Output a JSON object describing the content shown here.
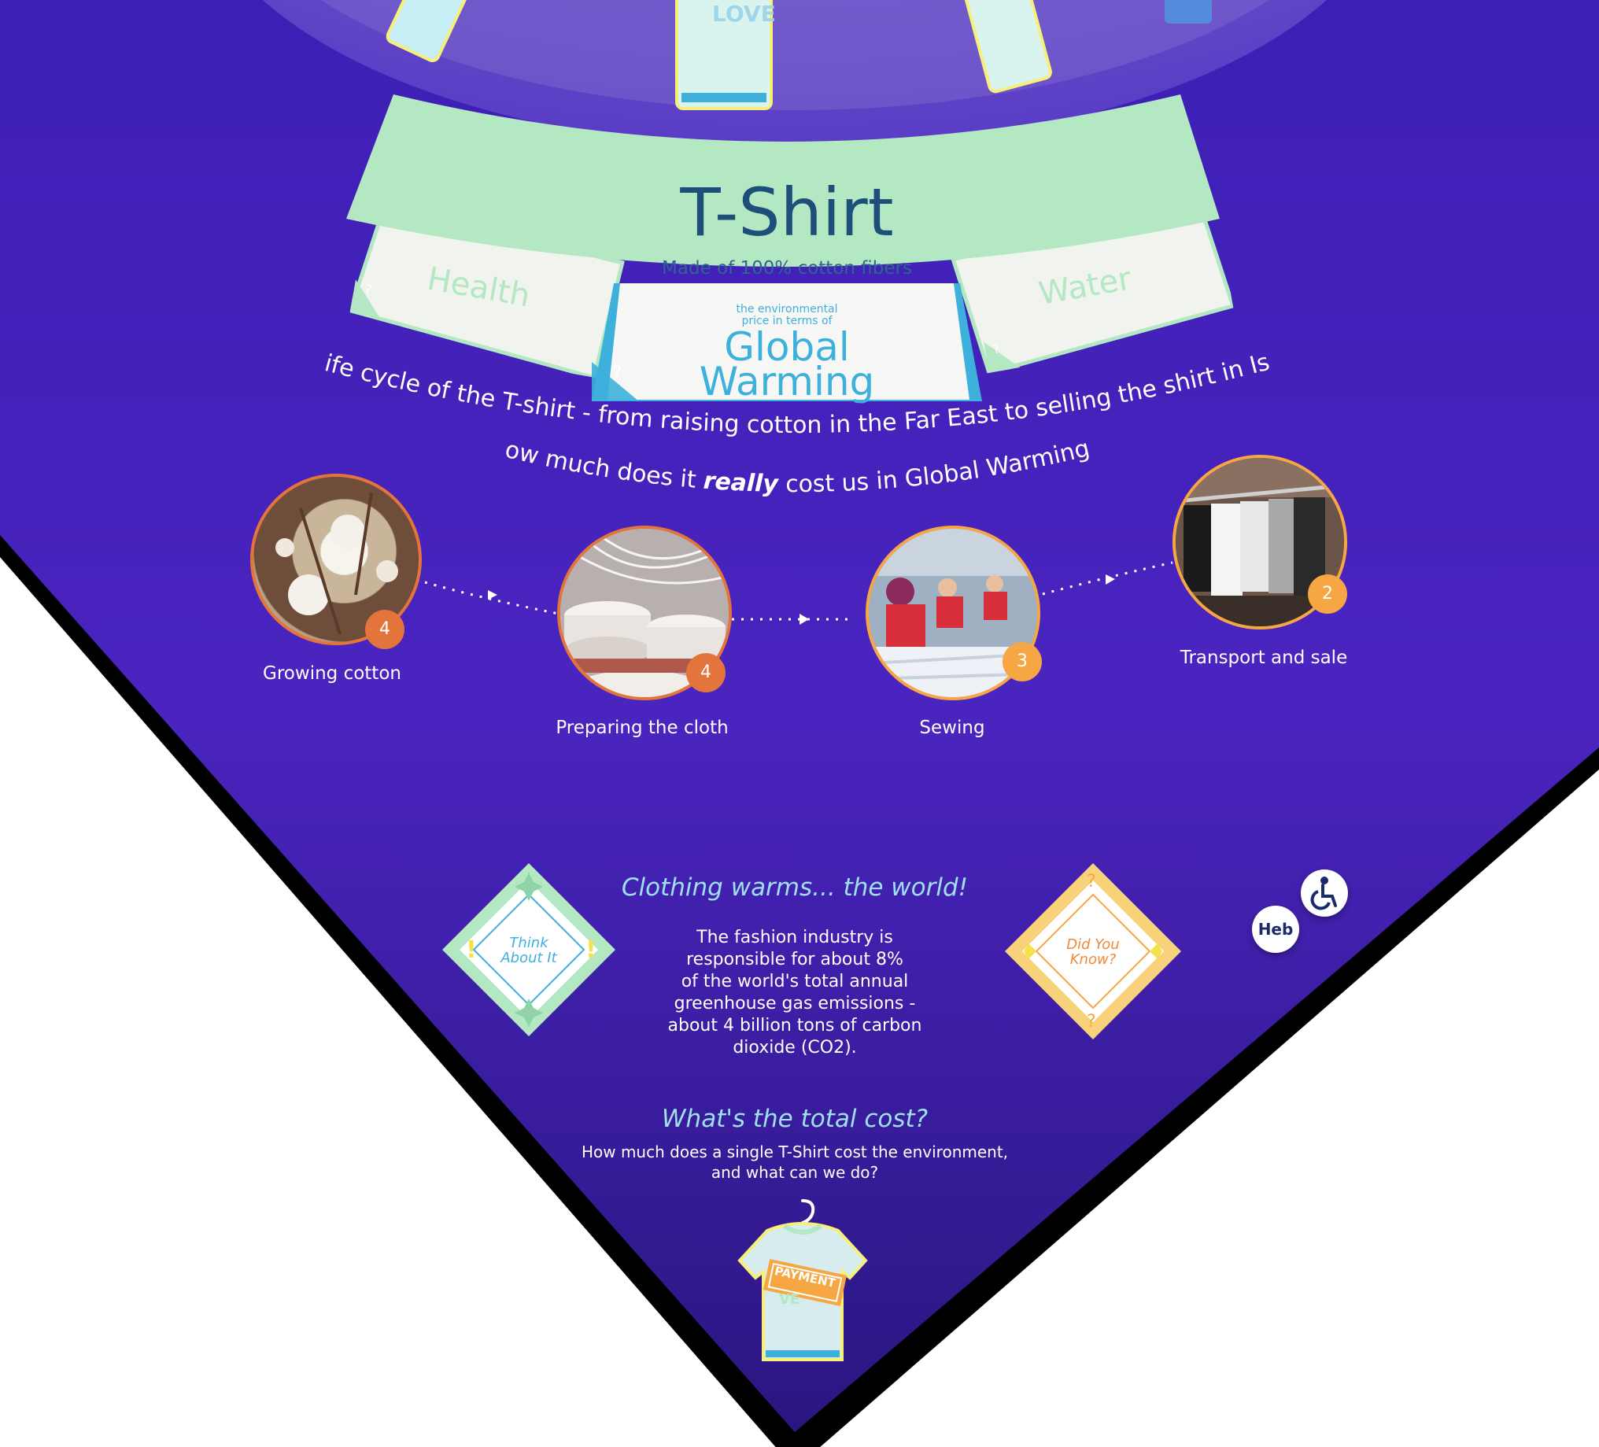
{
  "tshirt_card": {
    "title": "T-Shirt",
    "subtitle": "Made of 100% cotton fibers"
  },
  "tabs": {
    "health": {
      "label": "Health",
      "help": "?"
    },
    "water": {
      "label": "Water",
      "help": "?"
    },
    "global": {
      "prefix": "the environmental price in terms of",
      "line1": "Global",
      "line2": "Warming",
      "help": "?"
    }
  },
  "tshirt_print": "LOVE",
  "headline": {
    "line1": "The life cycle of the T-shirt - from raising cotton in the Far East to selling the shirt in Israel:",
    "line2_before": "How much does it ",
    "line2_emph": "really",
    "line2_after": " cost us in Global Warming?"
  },
  "steps": [
    {
      "label": "Growing cotton",
      "score": "4"
    },
    {
      "label": "Preparing the cloth",
      "score": "4"
    },
    {
      "label": "Sewing",
      "score": "3"
    },
    {
      "label": "Transport and sale",
      "score": "2"
    }
  ],
  "fact": {
    "title": "Clothing warms... the world!",
    "body_lines": [
      "The fashion industry is",
      "responsible for about 8%",
      "of the world's total annual",
      "greenhouse gas emissions -",
      "about 4 billion tons of carbon",
      "dioxide (CO2)."
    ]
  },
  "think_card": {
    "line1": "Think",
    "line2": "About It"
  },
  "know_card": {
    "line1": "Did You",
    "line2": "Know?"
  },
  "total": {
    "title": "What's the total cost?",
    "line1": "How much does a single T-Shirt cost the environment,",
    "line2": "and what can we do?",
    "tag": "PAYMENT"
  },
  "lang_button": "Heb",
  "colors": {
    "background": "#4520b8",
    "mint": "#b3e8c2",
    "accent_orange": "#e3743c",
    "accent_light_orange": "#f6a642",
    "blue": "#3eb0dc",
    "title_text": "#1e4f7a"
  }
}
